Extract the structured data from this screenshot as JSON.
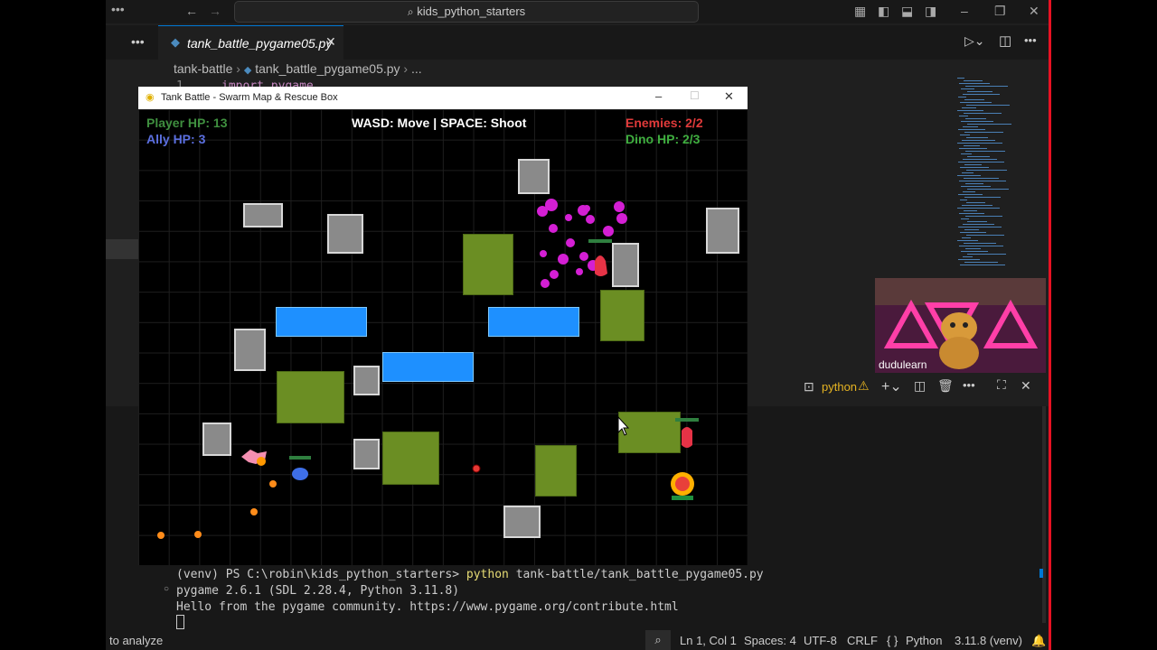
{
  "vscode": {
    "command_center": "kids_python_starters",
    "tab": "tank_battle_pygame05.py",
    "breadcrumb": [
      "tank-battle",
      "tank_battle_pygame05.py",
      "..."
    ],
    "code_fragment": "import pygame",
    "line_number": "1",
    "terminal_name": "python",
    "terminal_lines": [
      {
        "prompt": "(venv) PS C:\\robin\\kids_python_starters> ",
        "cmd": "python",
        "args": " tank-battle/tank_battle_pygame05.py"
      },
      {
        "text": "pygame 2.6.1 (SDL 2.28.4, Python 3.11.8)"
      },
      {
        "text": "Hello from the pygame community. https://www.pygame.org/contribute.html"
      }
    ],
    "status": {
      "left": "to analyze",
      "position": "Ln 1, Col 1",
      "spaces": "Spaces: 4",
      "encoding": "UTF-8",
      "eol": "CRLF",
      "language": "Python",
      "interpreter": "3.11.8 (venv)"
    }
  },
  "webcam": {
    "name": "dudulearn"
  },
  "game": {
    "window_title": "Tank Battle - Swarm Map & Rescue Box",
    "hud": {
      "player_hp": "Player HP: 13",
      "ally_hp": "Ally HP: 3",
      "controls": "WASD: Move | SPACE: Shoot",
      "enemies": "Enemies: 2/2",
      "dino_hp": "Dino HP: 2/3"
    },
    "colors": {
      "player_hp": "#3f8f3f",
      "ally_hp": "#5b6fe0",
      "enemies": "#e03a3a",
      "dino_hp": "#3fae3f",
      "wall": "#8a8a8a",
      "water": "#1e90ff",
      "bush": "#6b8e23"
    }
  }
}
